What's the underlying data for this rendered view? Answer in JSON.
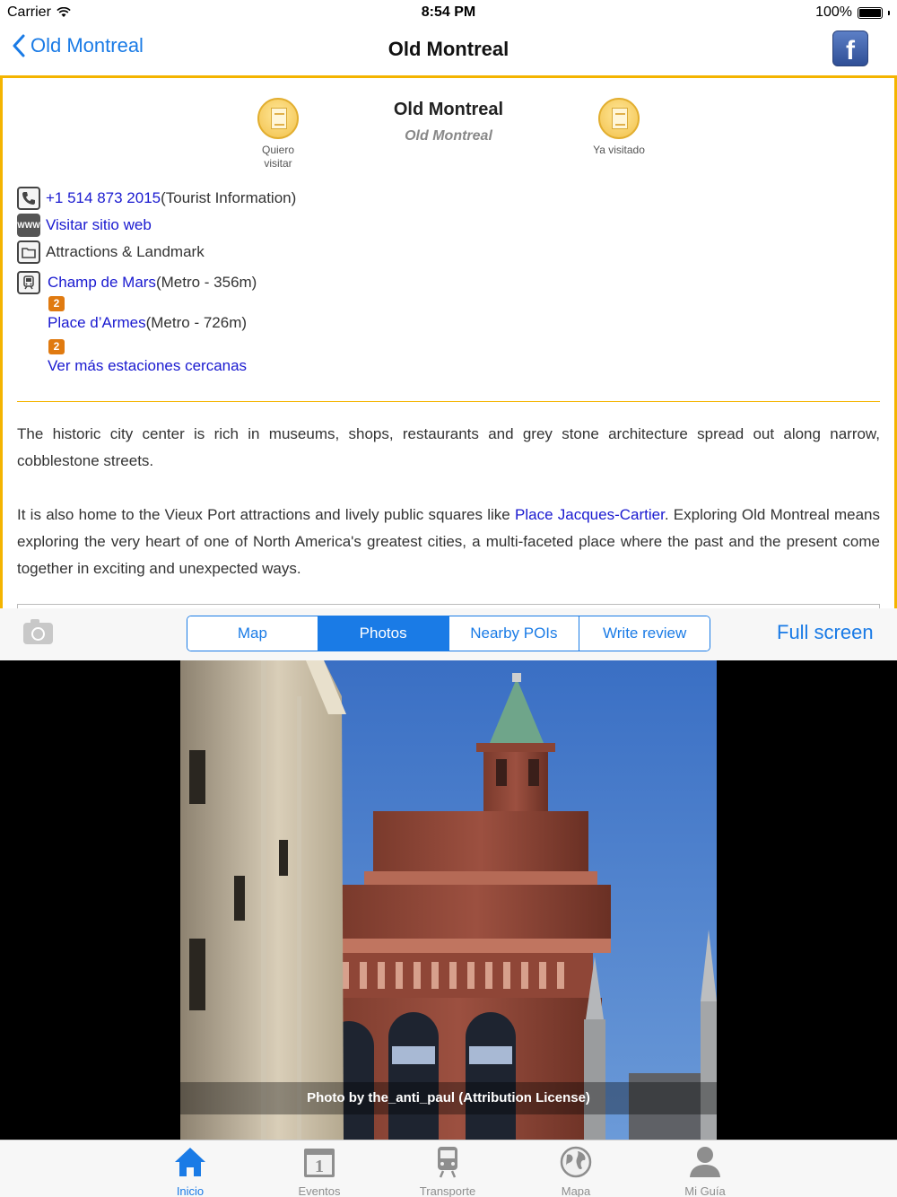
{
  "status_bar": {
    "carrier": "Carrier",
    "time": "8:54 PM",
    "battery": "100%"
  },
  "nav": {
    "back_label": "Old Montreal",
    "title": "Old Montreal"
  },
  "poi": {
    "title": "Old Montreal",
    "subtitle": "Old Montreal",
    "want_visit_label": "Quiero visitar",
    "visited_label": "Ya visitado",
    "phone": "+1 514 873 2015",
    "phone_note": "(Tourist Information)",
    "website_label": "Visitar sitio web",
    "category": "Attractions & Landmark",
    "stations": [
      {
        "name": "Champ de Mars",
        "detail": " (Metro - 356m)",
        "line": "2"
      },
      {
        "name": "Place d’Armes",
        "detail": " (Metro - 726m)",
        "line": "2"
      }
    ],
    "more_stations_label": "Ver más estaciones cercanas",
    "description_1": "The historic city center is rich in museums, shops, restaurants and grey stone architecture spread out along narrow, cobblestone streets.",
    "description_2_before": "It is also home to the Vieux Port attractions and lively public squares like ",
    "description_2_link": "Place Jacques-Cartier",
    "description_2_after": ". Exploring Old Montreal means exploring the very heart of one of North America's greatest cities, a multi-faceted place where the past and the present come together in exciting and unexpected ways."
  },
  "toolbar": {
    "tabs": [
      "Map",
      "Photos",
      "Nearby POIs",
      "Write review"
    ],
    "active_tab": "Photos",
    "fullscreen_label": "Full screen"
  },
  "photo": {
    "caption": "Photo by the_anti_paul (Attribution License)"
  },
  "tabbar": {
    "items": [
      {
        "label": "Inicio",
        "icon": "home-icon",
        "active": true
      },
      {
        "label": "Eventos",
        "icon": "calendar-icon",
        "active": false
      },
      {
        "label": "Transporte",
        "icon": "train-icon",
        "active": false
      },
      {
        "label": "Mapa",
        "icon": "globe-icon",
        "active": false
      },
      {
        "label": "Mi Guía",
        "icon": "person-icon",
        "active": false
      }
    ]
  },
  "colors": {
    "accent": "#1a7be6",
    "border": "#f4b400",
    "link": "#1a1ad0",
    "metro_badge": "#e07a10"
  }
}
